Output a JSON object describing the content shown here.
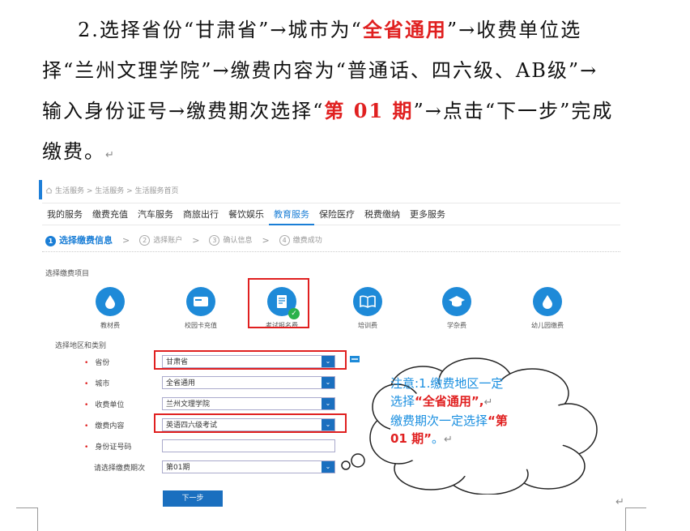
{
  "paragraph": {
    "line1_a": "2.选择省份“甘肃省”→城市为“",
    "line1_red": "全省通用",
    "line1_b": "”→收费单位选",
    "line2": "择“兰州文理学院”→缴费内容为“普通话、四六级、AB级”→",
    "line3_a": "输入身份证号→缴费期次选择“",
    "line3_red": "第 01 期",
    "line3_b": "”→点击“下一步”完成",
    "line4": "缴费。",
    "para_mark": "↵"
  },
  "screenshot": {
    "breadcrumb": "生活服务 > 生活服务 > 生活服务首页",
    "nav": [
      "我的服务",
      "缴费充值",
      "汽车服务",
      "商旅出行",
      "餐饮娱乐",
      "教育服务",
      "保险医疗",
      "税费缴纳",
      "更多服务"
    ],
    "nav_active": "教育服务",
    "steps": [
      {
        "num": "1",
        "label": "选择缴费信息"
      },
      {
        "num": "2",
        "label": "选择账户"
      },
      {
        "num": "3",
        "label": "确认信息"
      },
      {
        "num": "4",
        "label": "缴费成功"
      }
    ],
    "step_arrow": ">",
    "section_items": "选择缴费项目",
    "items": [
      "教材费",
      "校园卡充值",
      "考试报名费",
      "培训费",
      "学杂费",
      "幼儿园缴费"
    ],
    "section_region": "选择地区和类别",
    "form": {
      "province_label": "省份",
      "province_value": "甘肃省",
      "city_label": "城市",
      "city_value": "全省通用",
      "unit_label": "收费单位",
      "unit_value": "兰州文理学院",
      "content_label": "缴费内容",
      "content_value": "英语四六级考试",
      "id_label": "身份证号码",
      "id_value": "",
      "period_label": "请选择缴费期次",
      "period_value": "第01期"
    },
    "next_button": "下一步"
  },
  "callout": {
    "line1": "注意:1.缴费地区一定",
    "line2_a": "选择",
    "line2_red": "“全省通用”,",
    "line3_a": "缴费期次一定选择",
    "line3_red": "“第",
    "line4_red": "01 期”",
    "line4_b": "。"
  }
}
